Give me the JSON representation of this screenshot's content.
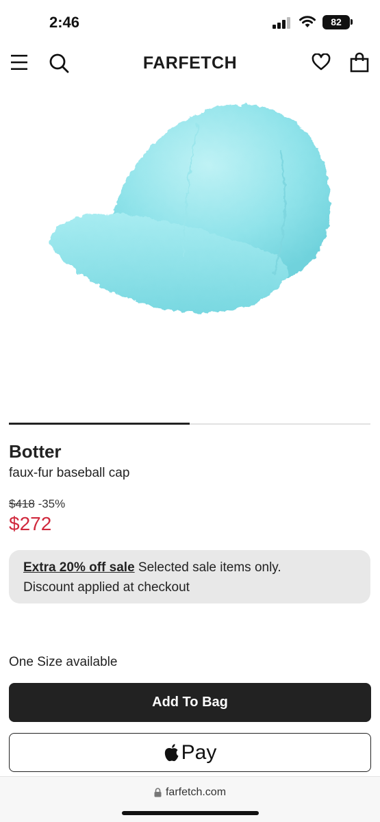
{
  "status_bar": {
    "time": "2:46",
    "battery": "82"
  },
  "header": {
    "brand": "FARFETCH"
  },
  "product": {
    "brand": "Botter",
    "name": "faux-fur baseball cap",
    "original_price": "$418",
    "discount": "-35%",
    "sale_price": "$272",
    "image_color": "#8fe3ea"
  },
  "promo": {
    "link_text": "Extra 20% off sale",
    "text": " Selected sale items only.",
    "text2": "Discount applied at checkout"
  },
  "size": {
    "availability": "One Size available"
  },
  "actions": {
    "add_to_bag": "Add To Bag",
    "apple_pay": "Pay"
  },
  "browser": {
    "url": "farfetch.com"
  },
  "colors": {
    "sale": "#d0293d",
    "dark": "#222222",
    "promo_bg": "#e8e8e8"
  }
}
